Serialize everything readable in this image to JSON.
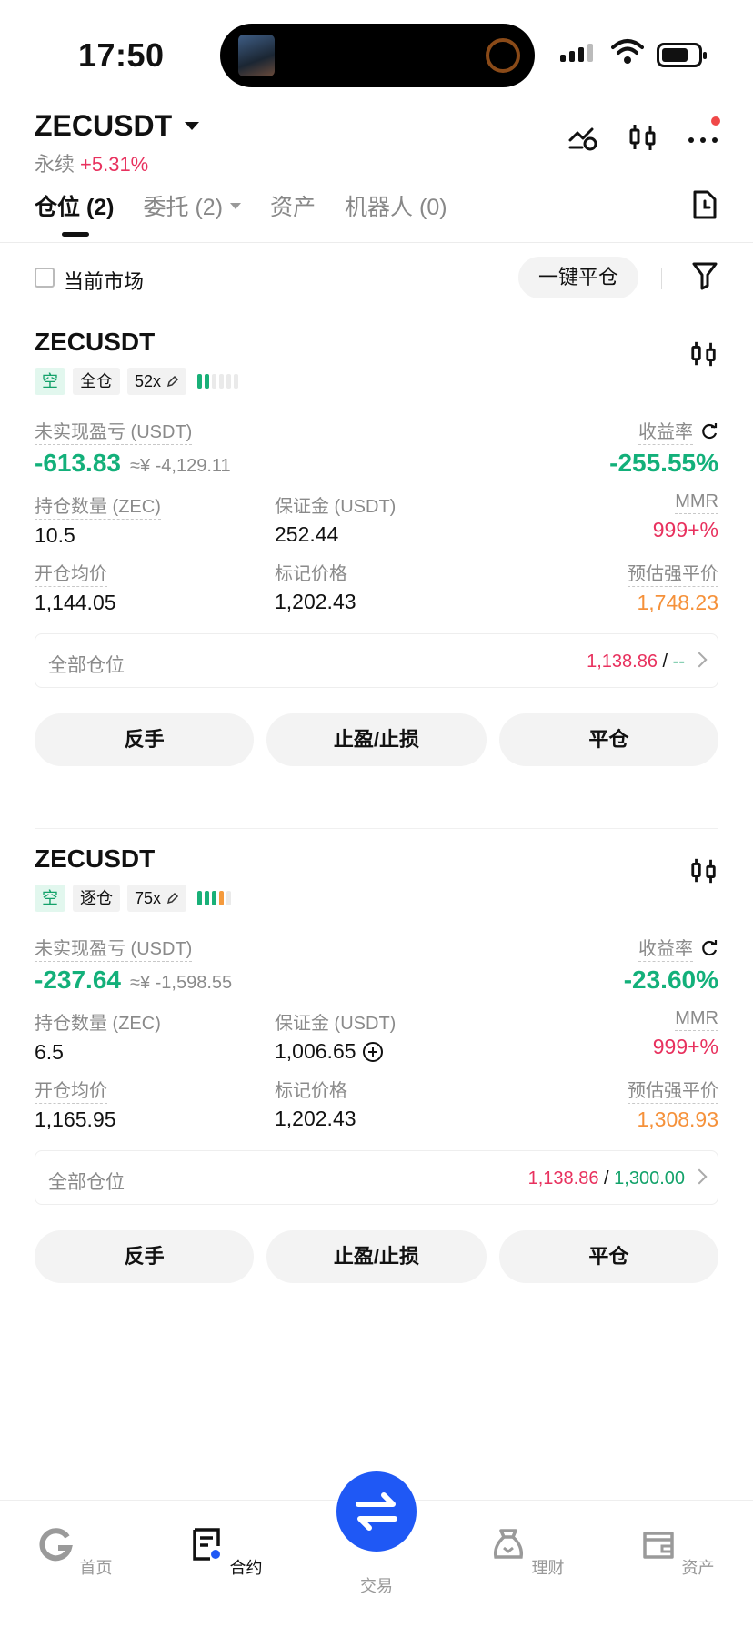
{
  "status_bar": {
    "time": "17:50"
  },
  "header": {
    "symbol": "ZECUSDT",
    "type": "永续",
    "change": "+5.31%"
  },
  "tabs": [
    {
      "label": "仓位 (2)",
      "active": true
    },
    {
      "label": "委托 (2)",
      "active": false,
      "dropdown": true
    },
    {
      "label": "资产",
      "active": false
    },
    {
      "label": "机器人 (0)",
      "active": false
    }
  ],
  "filter": {
    "current_market_label": "当前市场",
    "close_all_label": "一键平仓"
  },
  "labels": {
    "unrealized_pnl": "未实现盈亏 (USDT)",
    "roi": "收益率",
    "size": "持仓数量 (ZEC)",
    "margin": "保证金 (USDT)",
    "mmr": "MMR",
    "entry_price": "开仓均价",
    "mark_price": "标记价格",
    "liq_price": "预估强平价",
    "all_positions": "全部仓位",
    "btn_reverse": "反手",
    "btn_tpsl": "止盈/止损",
    "btn_close": "平仓"
  },
  "positions": [
    {
      "symbol": "ZECUSDT",
      "side": "空",
      "margin_mode": "全仓",
      "leverage": "52x",
      "pnl": "-613.83",
      "pnl_cny": "≈¥ -4,129.11",
      "roi": "-255.55%",
      "size": "10.5",
      "margin": "252.44",
      "mmr": "999+%",
      "entry_price": "1,144.05",
      "mark_price": "1,202.43",
      "liq_price": "1,748.23",
      "tp": "1,138.86",
      "sep": "/",
      "sl": "--"
    },
    {
      "symbol": "ZECUSDT",
      "side": "空",
      "margin_mode": "逐仓",
      "leverage": "75x",
      "pnl": "-237.64",
      "pnl_cny": "≈¥ -1,598.55",
      "roi": "-23.60%",
      "size": "6.5",
      "margin": "1,006.65",
      "mmr": "999+%",
      "entry_price": "1,165.95",
      "mark_price": "1,202.43",
      "liq_price": "1,308.93",
      "tp": "1,138.86",
      "sep": "/",
      "sl": "1,300.00"
    }
  ],
  "bottom_nav": [
    {
      "label": "首页",
      "icon": "home-icon"
    },
    {
      "label": "合约",
      "icon": "contract-icon",
      "active": true
    },
    {
      "label": "交易",
      "icon": "swap-icon"
    },
    {
      "label": "理财",
      "icon": "earn-icon"
    },
    {
      "label": "资产",
      "icon": "wallet-icon"
    }
  ],
  "colors": {
    "up": "#e8315e",
    "down": "#13b07a",
    "liq": "#f5913a",
    "accent": "#1f58f5"
  }
}
